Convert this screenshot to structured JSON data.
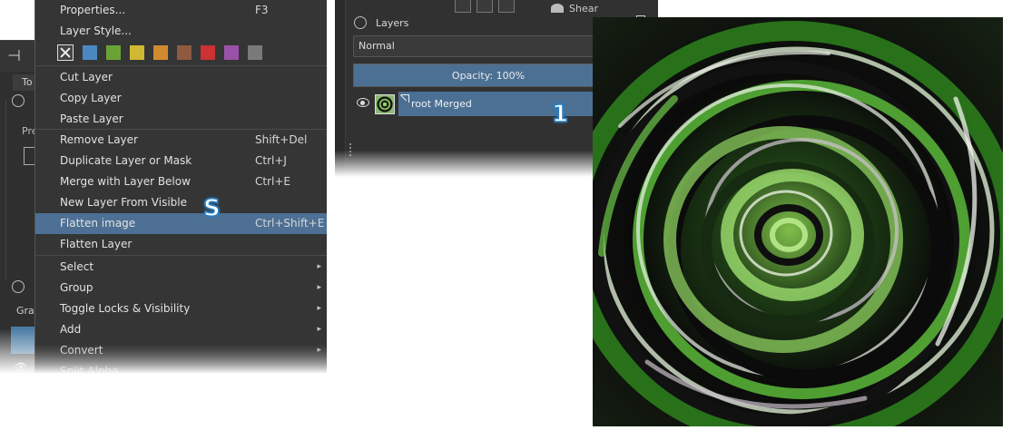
{
  "left_panel": {
    "tab_label": "To",
    "preset_label": "Pre",
    "brush_label": "Grai",
    "crop_icon": "crop-icon",
    "lock_icon": "lock-icon",
    "eye_icon": "eye-icon"
  },
  "menu": {
    "items": [
      {
        "label": "Properties...",
        "shortcut": "F3"
      },
      {
        "label": "Layer Style...",
        "shortcut": ""
      },
      {
        "label": "Cut Layer",
        "shortcut": ""
      },
      {
        "label": "Copy Layer",
        "shortcut": ""
      },
      {
        "label": "Paste Layer",
        "shortcut": ""
      },
      {
        "label": "Remove Layer",
        "shortcut": "Shift+Del"
      },
      {
        "label": "Duplicate Layer or Mask",
        "shortcut": "Ctrl+J"
      },
      {
        "label": "Merge with Layer Below",
        "shortcut": "Ctrl+E"
      },
      {
        "label": "New Layer From Visible",
        "shortcut": ""
      },
      {
        "label": "Flatten image",
        "shortcut": "Ctrl+Shift+E"
      },
      {
        "label": "Flatten Layer",
        "shortcut": ""
      },
      {
        "label": "Select",
        "shortcut": ""
      },
      {
        "label": "Group",
        "shortcut": ""
      },
      {
        "label": "Toggle Locks & Visibility",
        "shortcut": ""
      },
      {
        "label": "Add",
        "shortcut": ""
      },
      {
        "label": "Convert",
        "shortcut": ""
      },
      {
        "label": "Split Alpha",
        "shortcut": ""
      }
    ],
    "color_labels": [
      "none",
      "#4b88c2",
      "#6aa236",
      "#d0b833",
      "#d08a30",
      "#8e5a40",
      "#cc3232",
      "#9a52a8",
      "#7a7a7a"
    ],
    "highlight_color": "#4d7094",
    "submenu_arrow": "▸",
    "badge_s": "S"
  },
  "layers": {
    "title": "Layers",
    "blend_mode": "Normal",
    "opacity": "Opacity:  100%",
    "layer_name": "root Merged",
    "badge_1": "1",
    "shear_label": "Shear",
    "alpha_icon": "alpha-icon",
    "filter_icon": "filter-icon"
  }
}
